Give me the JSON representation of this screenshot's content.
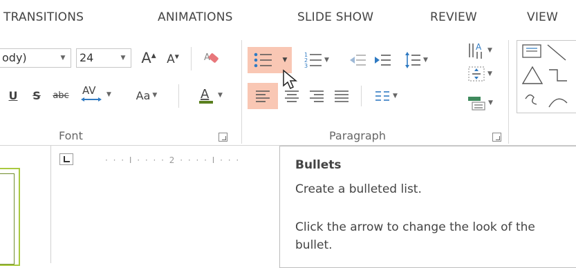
{
  "tabs": [
    "TRANSITIONS",
    "ANIMATIONS",
    "SLIDE SHOW",
    "REVIEW",
    "VIEW"
  ],
  "font": {
    "family_value": "ody)",
    "size_value": "24",
    "change_case_label": "Aa",
    "group_label": "Font"
  },
  "paragraph": {
    "group_label": "Paragraph"
  },
  "ruler": {
    "marks": "· · · I · · · · 2 · · · · I · · ·",
    "number": ""
  },
  "tooltip": {
    "title": "Bullets",
    "description": "Create a bulleted list.",
    "detail": "Click the arrow to change the look of the bullet."
  },
  "colors": {
    "bullets_highlight": "#f9c7b4",
    "font_color_underline": "#5a7f1e",
    "thumbnail_border": "#a9c93f"
  }
}
